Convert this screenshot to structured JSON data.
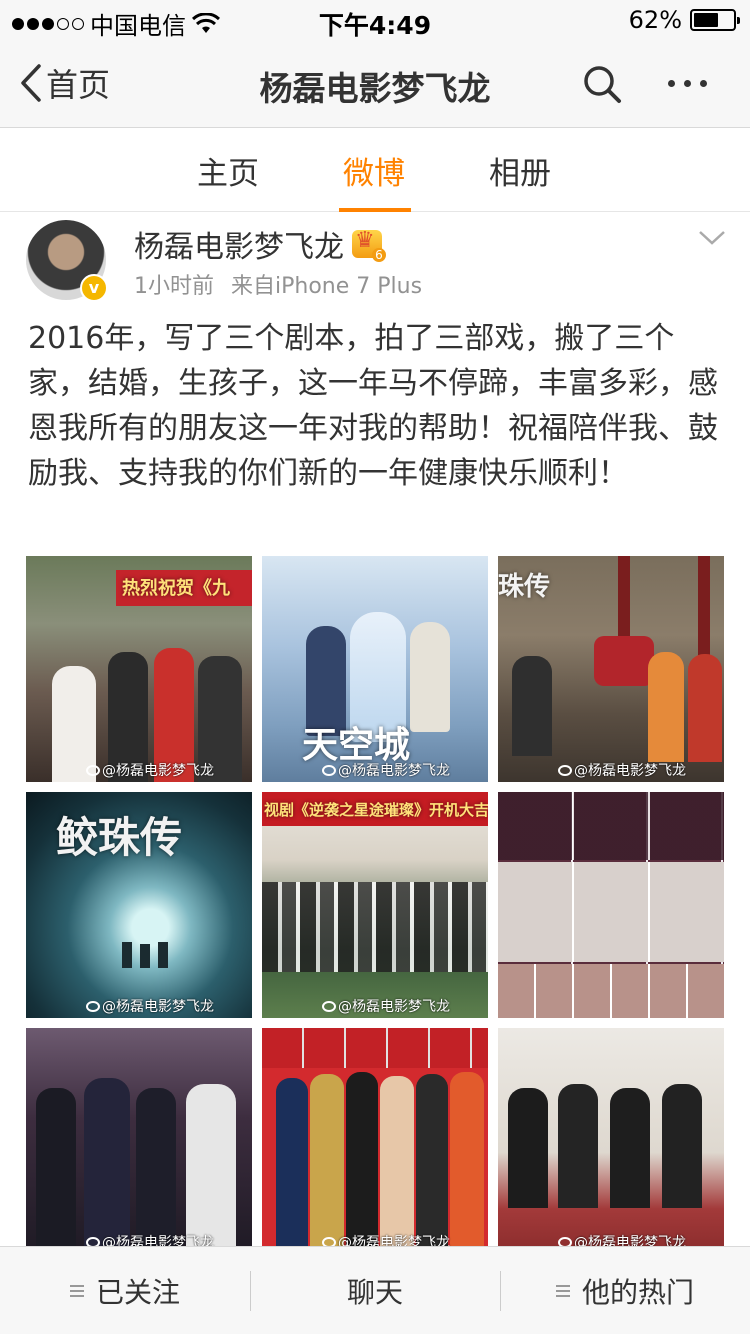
{
  "status_bar": {
    "carrier": "中国电信",
    "time": "下午4:49",
    "battery": "62%",
    "battery_level": 0.62,
    "signal_bars_filled": 3,
    "signal_bars_total": 5
  },
  "nav": {
    "back_label": "首页",
    "title": "杨磊电影梦飞龙",
    "icons": [
      "back-chevron-icon",
      "search-icon",
      "more-icon"
    ]
  },
  "tabs": [
    {
      "label": "主页",
      "active": false
    },
    {
      "label": "微博",
      "active": true
    },
    {
      "label": "相册",
      "active": false
    }
  ],
  "post": {
    "author": "杨磊电影梦飞龙",
    "time": "1小时前",
    "source": "来自iPhone 7 Plus",
    "text": "2016年，写了三个剧本，拍了三部戏，搬了三个家，结婚，生孩子，这一年马不停蹄，丰富多彩，感恩我所有的朋友这一年对我的帮助！祝福陪伴我、鼓励我、支持我的你们新的一年健康快乐顺利！",
    "watermark": "@杨磊电影梦飞龙",
    "images": [
      {
        "name": "photo-1",
        "caption": "热烈祝贺《九"
      },
      {
        "name": "photo-2",
        "caption": "天空城"
      },
      {
        "name": "photo-3",
        "caption": "珠传"
      },
      {
        "name": "photo-4",
        "caption": "鲛珠传"
      },
      {
        "name": "photo-5",
        "caption": "视剧《逆袭之星途璀璨》开机大吉"
      },
      {
        "name": "photo-6",
        "caption": ""
      },
      {
        "name": "photo-7",
        "caption": ""
      },
      {
        "name": "photo-8",
        "caption": ""
      },
      {
        "name": "photo-9",
        "caption": ""
      }
    ]
  },
  "bottom_bar": {
    "follow_label": "已关注",
    "chat_label": "聊天",
    "hot_label": "他的热门"
  },
  "colors": {
    "accent": "#ff8200",
    "text": "#333333",
    "meta": "#929292",
    "bar_bg": "#f7f7f7"
  }
}
